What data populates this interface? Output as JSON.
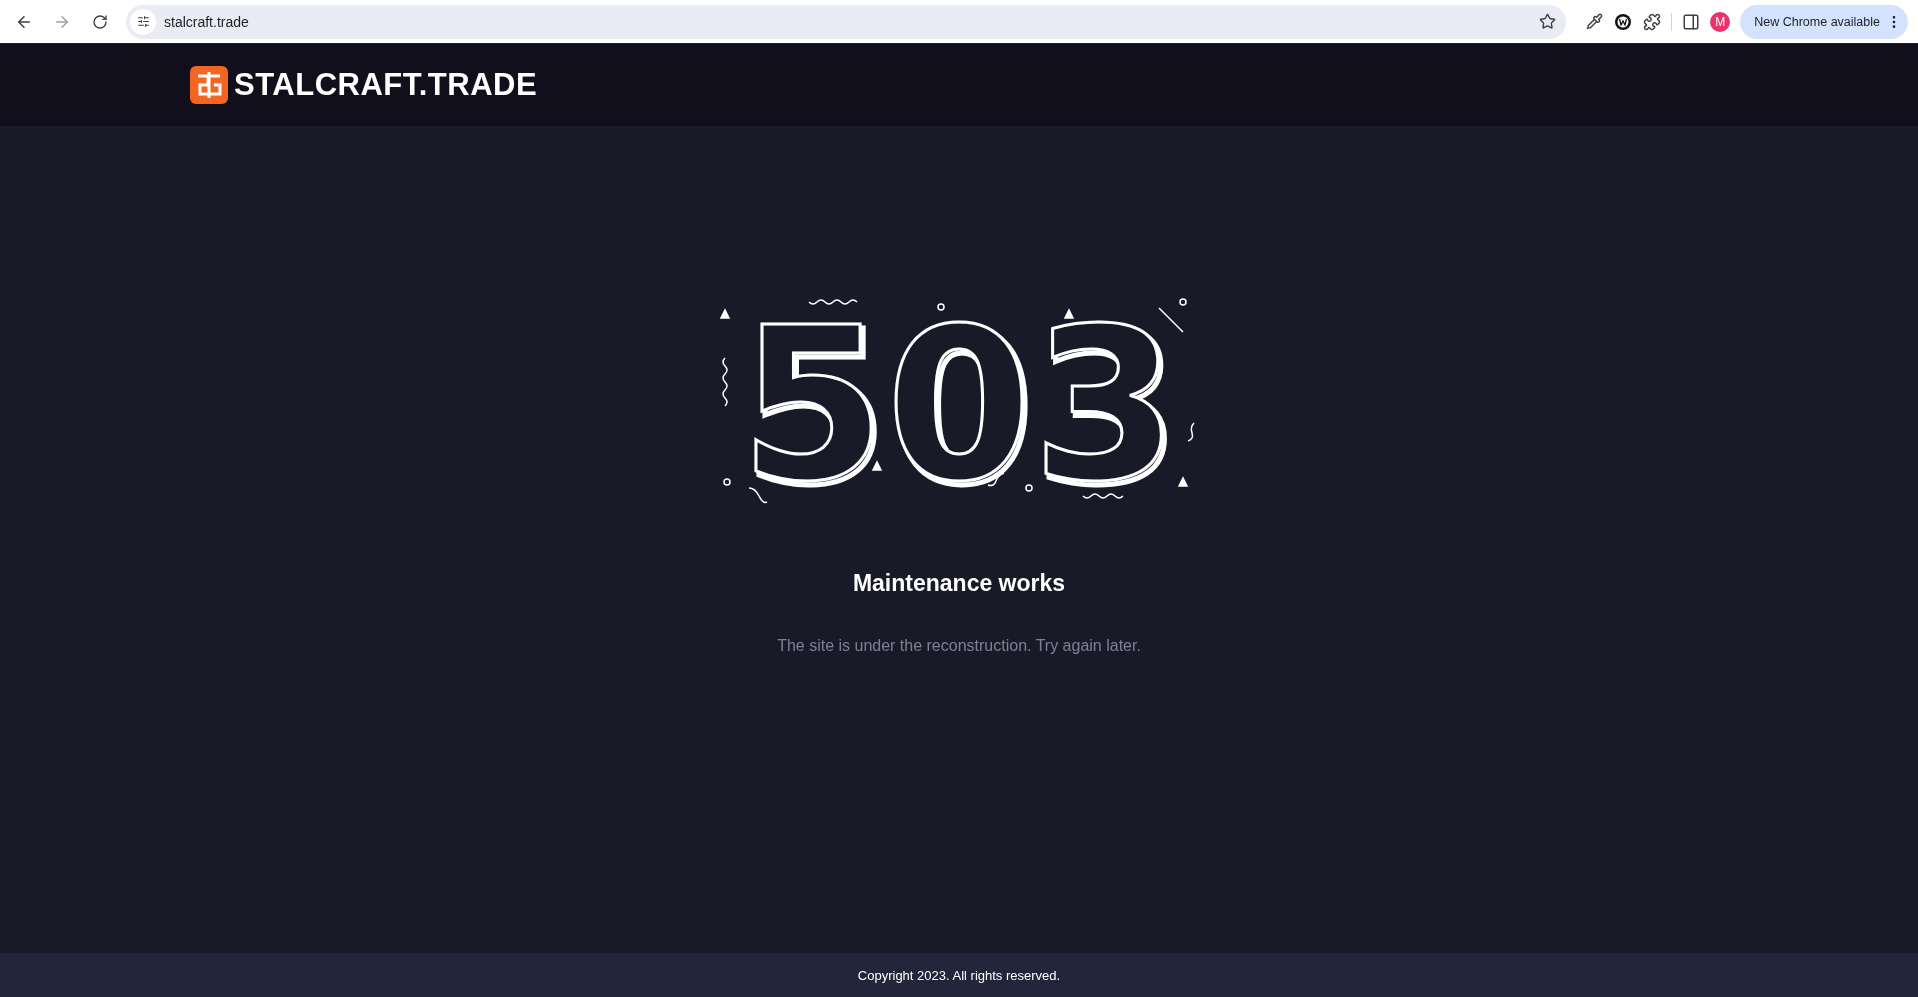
{
  "browser": {
    "url": "stalcraft.trade",
    "update_button": "New Chrome available",
    "profile_initial": "M"
  },
  "header": {
    "logo_text": "STALCRAFT.TRADE"
  },
  "error": {
    "code": "503",
    "title": "Maintenance works",
    "message": "The site is under the reconstruction. Try again later."
  },
  "footer": {
    "copyright": "Copyright 2023. All rights reserved."
  }
}
